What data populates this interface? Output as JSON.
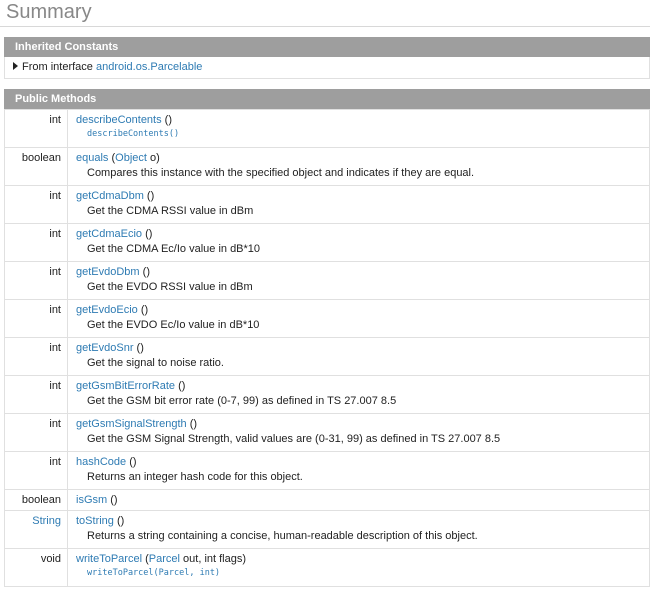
{
  "summary_title": "Summary",
  "inherited": {
    "header": "Inherited Constants",
    "prefix": "From interface",
    "link": "android.os.Parcelable"
  },
  "public_methods": {
    "header": "Public Methods",
    "rows": [
      {
        "type": "int",
        "type_is_link": false,
        "name": "describeContents",
        "params": [],
        "desc": "",
        "code_desc": "describeContents()"
      },
      {
        "type": "boolean",
        "type_is_link": false,
        "name": "equals",
        "params": [
          {
            "type": "Object",
            "type_is_link": true,
            "name": " o"
          }
        ],
        "desc": "Compares this instance with the specified object and indicates if they are equal.",
        "code_desc": ""
      },
      {
        "type": "int",
        "type_is_link": false,
        "name": "getCdmaDbm",
        "params": [],
        "desc": "Get the CDMA RSSI value in dBm",
        "code_desc": ""
      },
      {
        "type": "int",
        "type_is_link": false,
        "name": "getCdmaEcio",
        "params": [],
        "desc": "Get the CDMA Ec/Io value in dB*10",
        "code_desc": ""
      },
      {
        "type": "int",
        "type_is_link": false,
        "name": "getEvdoDbm",
        "params": [],
        "desc": "Get the EVDO RSSI value in dBm",
        "code_desc": ""
      },
      {
        "type": "int",
        "type_is_link": false,
        "name": "getEvdoEcio",
        "params": [],
        "desc": "Get the EVDO Ec/Io value in dB*10",
        "code_desc": ""
      },
      {
        "type": "int",
        "type_is_link": false,
        "name": "getEvdoSnr",
        "params": [],
        "desc": "Get the signal to noise ratio.",
        "code_desc": ""
      },
      {
        "type": "int",
        "type_is_link": false,
        "name": "getGsmBitErrorRate",
        "params": [],
        "desc": "Get the GSM bit error rate (0-7, 99) as defined in TS 27.007 8.5",
        "code_desc": ""
      },
      {
        "type": "int",
        "type_is_link": false,
        "name": "getGsmSignalStrength",
        "params": [],
        "desc": "Get the GSM Signal Strength, valid values are (0-31, 99) as defined in TS 27.007 8.5",
        "code_desc": ""
      },
      {
        "type": "int",
        "type_is_link": false,
        "name": "hashCode",
        "params": [],
        "desc": "Returns an integer hash code for this object.",
        "code_desc": ""
      },
      {
        "type": "boolean",
        "type_is_link": false,
        "name": "isGsm",
        "params": [],
        "desc": "",
        "code_desc": ""
      },
      {
        "type": "String",
        "type_is_link": true,
        "name": "toString",
        "params": [],
        "desc": "Returns a string containing a concise, human-readable description of this object.",
        "code_desc": ""
      },
      {
        "type": "void",
        "type_is_link": false,
        "name": "writeToParcel",
        "params": [
          {
            "type": "Parcel",
            "type_is_link": true,
            "name": " out"
          },
          {
            "type": "int",
            "type_is_link": false,
            "name": " flags"
          }
        ],
        "desc": "",
        "code_desc": "writeToParcel(Parcel, int)"
      }
    ]
  },
  "colors": {
    "link": "#2e7bb3",
    "header_bg": "#9e9e9e",
    "title": "#888888"
  }
}
